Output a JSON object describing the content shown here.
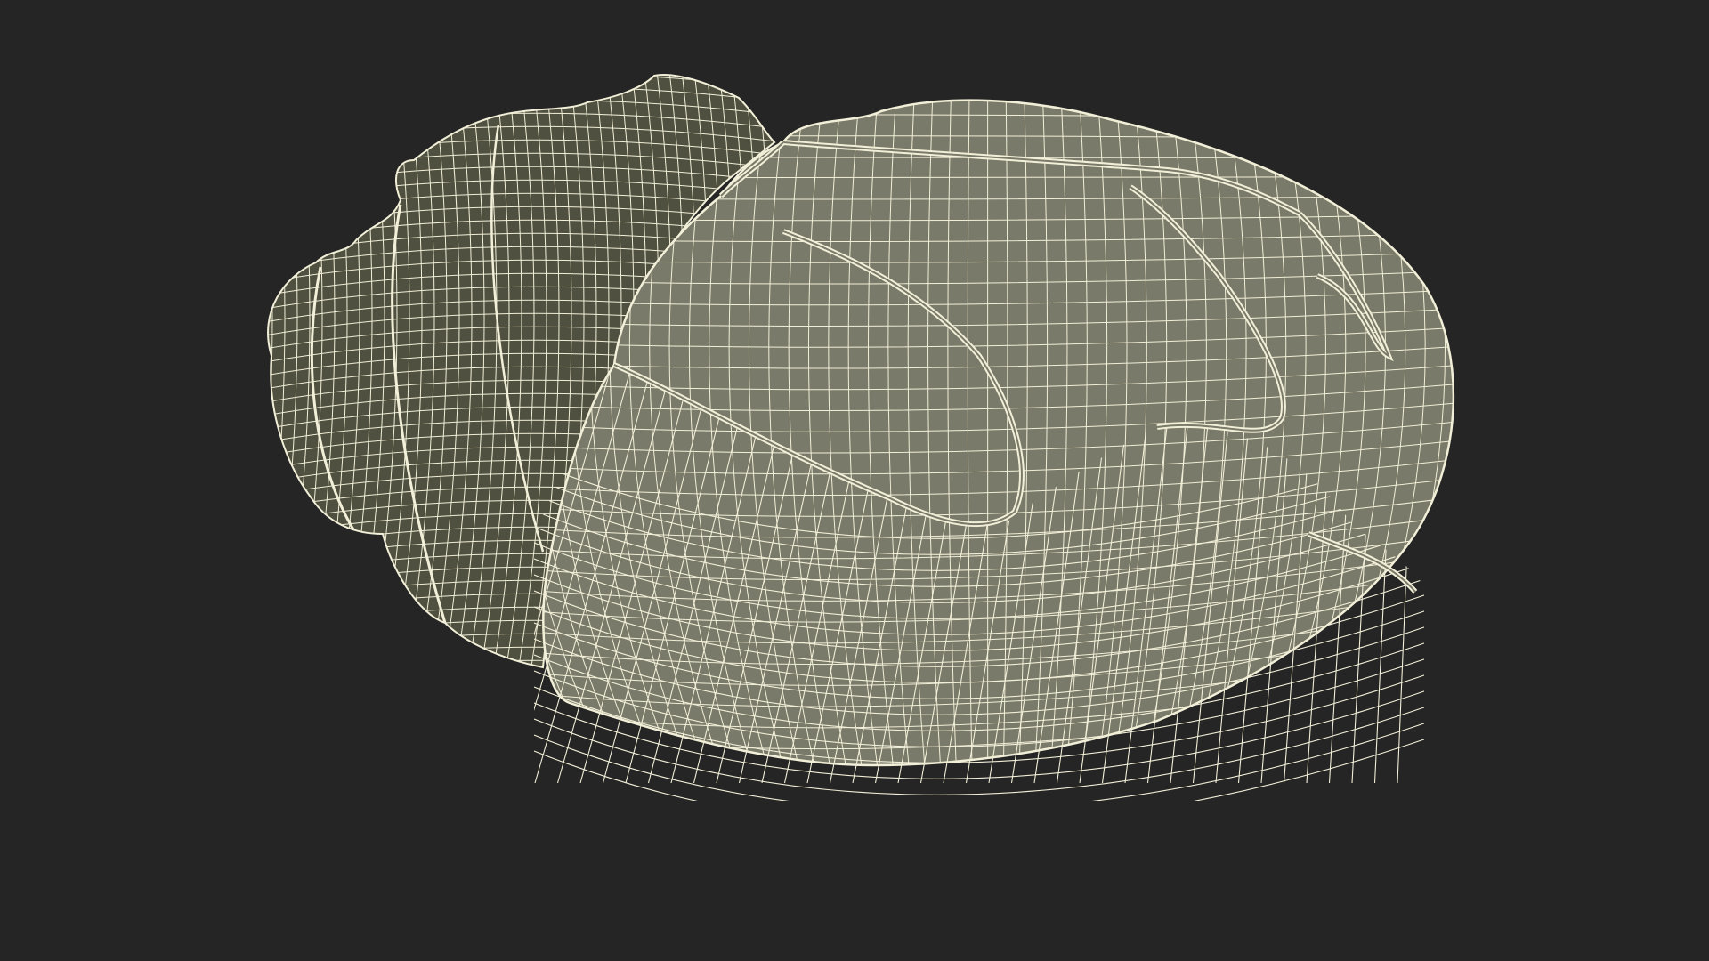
{
  "scene": {
    "background_color": "#252525",
    "mesh_fill_color": "#797a69",
    "mesh_shadow_color": "#4f5040",
    "wire_color": "#f2efd8",
    "model_name": "",
    "render_mode": "wireframe-on-shaded"
  }
}
